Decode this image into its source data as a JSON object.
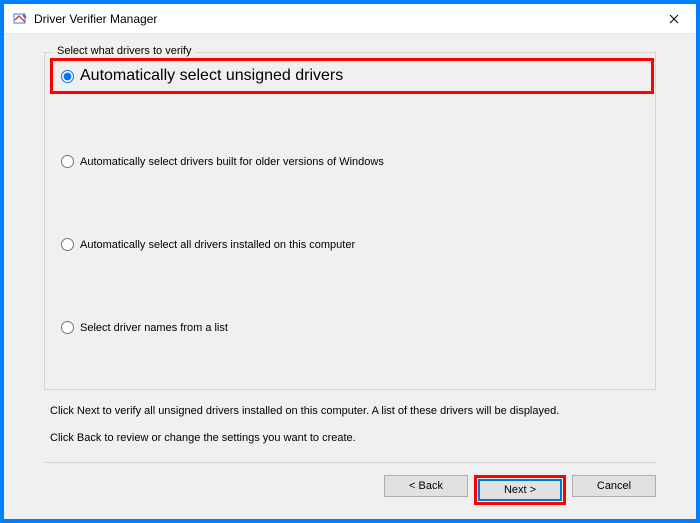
{
  "window": {
    "title": "Driver Verifier Manager"
  },
  "groupbox": {
    "title": "Select what drivers to verify"
  },
  "options": {
    "opt1": "Automatically select unsigned drivers",
    "opt2": "Automatically select drivers built for older versions of Windows",
    "opt3": "Automatically select all drivers installed on this computer",
    "opt4": "Select driver names from a list"
  },
  "instructions": {
    "line1": "Click Next to verify all unsigned drivers installed on this computer. A list of these drivers will be displayed.",
    "line2": "Click Back to review or change the settings you want to create."
  },
  "buttons": {
    "back": "< Back",
    "next": "Next >",
    "cancel": "Cancel"
  }
}
